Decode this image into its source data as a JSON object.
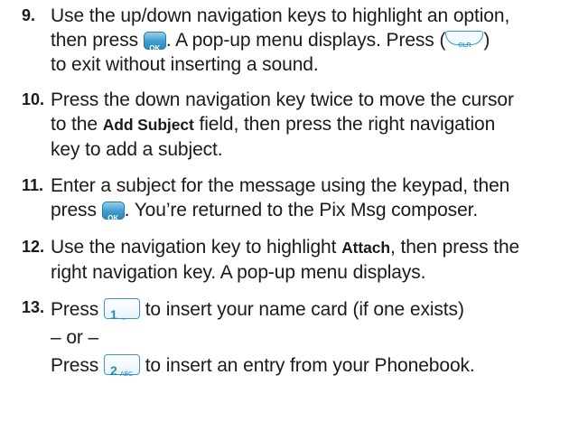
{
  "steps": [
    {
      "number": "9.",
      "parts": {
        "a": "Use the up/down navigation keys to highlight an option,",
        "b": "then press",
        "c": ". A pop-up menu displays. Press (",
        "d": ")",
        "e": "to exit without inserting a sound."
      }
    },
    {
      "number": "10.",
      "parts": {
        "a": "Press the down navigation key twice to move the cursor",
        "b": "to the",
        "c": "Add Subject",
        "d": "field, then press the right navigation",
        "e": "key to add a subject."
      }
    },
    {
      "number": "11.",
      "parts": {
        "a": "Enter a subject for the message using the keypad, then",
        "b": "press",
        "c": ". You’re returned to the Pix Msg composer."
      }
    },
    {
      "number": "12.",
      "parts": {
        "a": "Use the navigation key to highlight",
        "b": "Attach",
        "c": ", then press the",
        "d": "right navigation key. A pop-up menu displays."
      }
    },
    {
      "number": "13.",
      "parts": {
        "a": "Press",
        "b": "to insert your name card (if one exists)",
        "c": "– or –",
        "d": "Press",
        "e": "to insert an entry from your Phonebook."
      }
    }
  ],
  "keys": {
    "ok": "OK",
    "clr": "CLR",
    "one": {
      "digit": "1",
      "sub": "…"
    },
    "two": {
      "digit": "2",
      "sub": "ABC"
    }
  },
  "icons": [
    "ok-key-icon",
    "clr-key-icon",
    "one-key-icon",
    "two-key-icon"
  ]
}
